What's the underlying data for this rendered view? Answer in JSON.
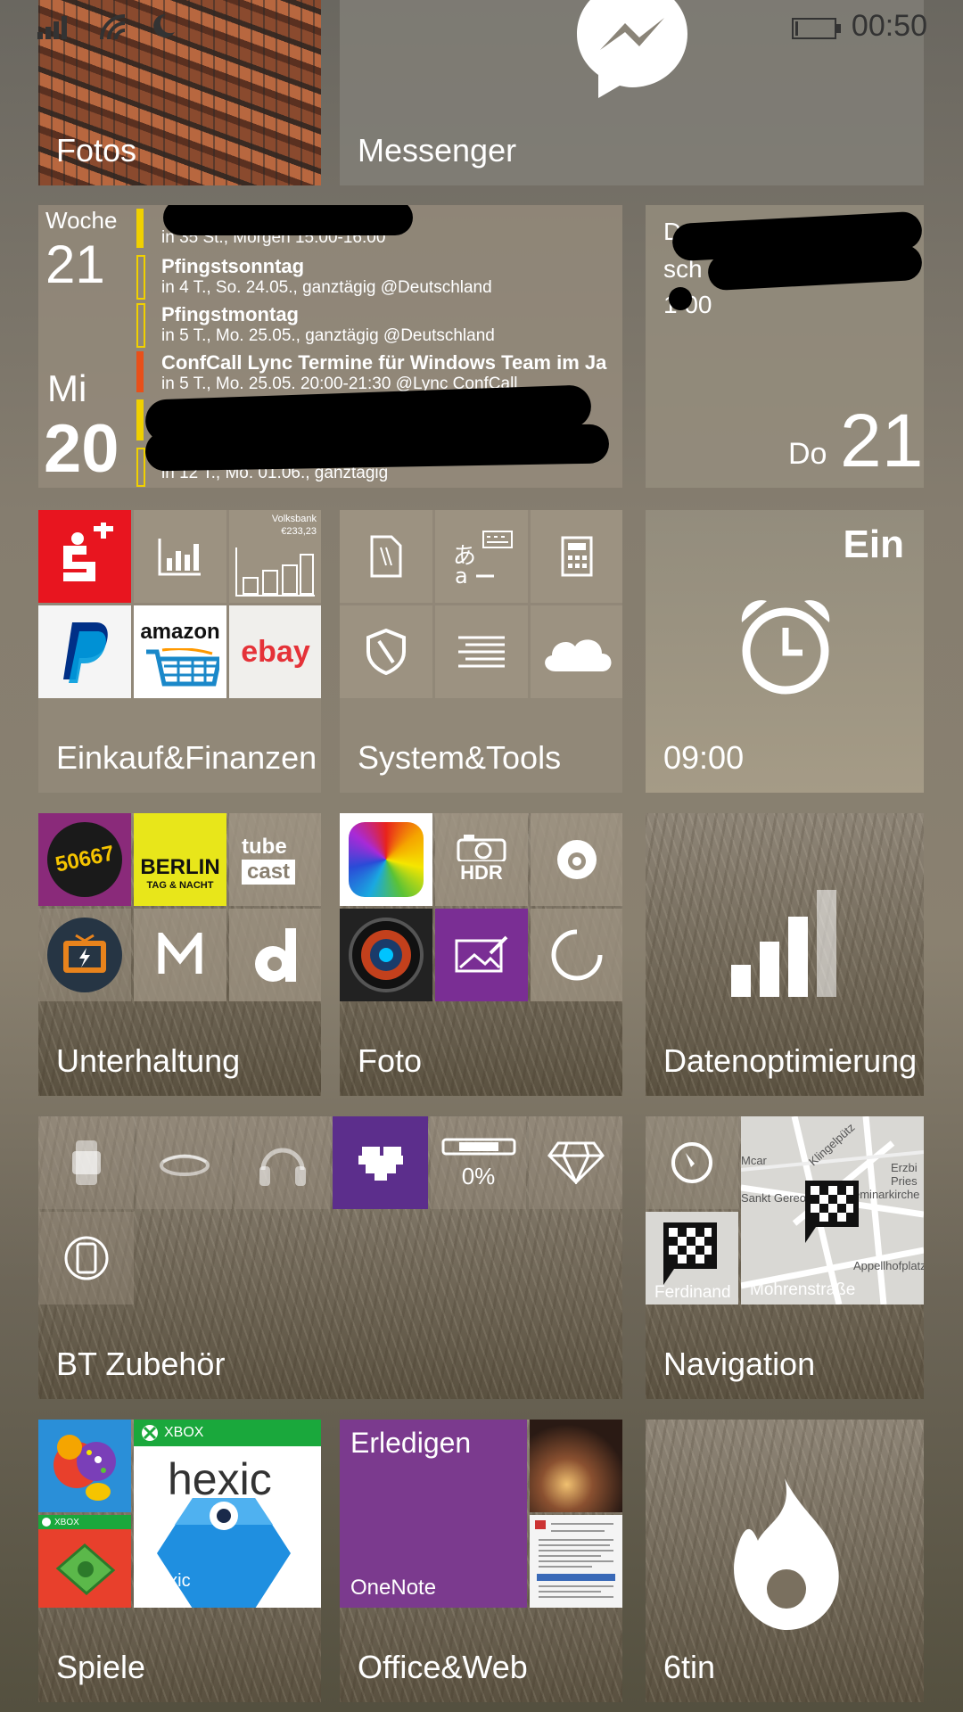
{
  "status_bar": {
    "time": "00:50"
  },
  "tiles": {
    "photos": {
      "label": "Fotos"
    },
    "messenger": {
      "label": "Messenger"
    },
    "calendar": {
      "week_label": "Woche",
      "week_number": "21",
      "weekday": "Mi",
      "day": "20",
      "events": [
        {
          "title": "",
          "sub": "in 35 St., Morgen 15:00-16:00",
          "color": "#f0d000"
        },
        {
          "title": "Pfingstsonntag",
          "sub": "in 4 T., So. 24.05., ganztägig @Deutschland",
          "color": "#f0d000"
        },
        {
          "title": "Pfingstmontag",
          "sub": "in 5 T., Mo. 25.05., ganztägig @Deutschland",
          "color": "#f0d000"
        },
        {
          "title": "ConfCall Lync Termine für Windows Team im Ja",
          "sub": "in 5 T., Mo. 25.05. 20:00-21:30 @Lync ConfCall",
          "color": "#e8501a"
        },
        {
          "title": "",
          "sub": "",
          "color": "#f0d000"
        },
        {
          "title": "",
          "sub": "in 12 T., Mo. 01.06., ganztägig",
          "color": "#f0d000"
        }
      ]
    },
    "reminder": {
      "line1": "D",
      "line2": "sch",
      "line3": "1 00",
      "weekday": "Do",
      "day": "21"
    },
    "shopping": {
      "label": "Einkauf&Finanzen",
      "volksbank_name": "Volksbank",
      "volksbank_amount": "€233,23",
      "amazon": "amazon",
      "ebay": "ebay"
    },
    "system": {
      "label": "System&Tools"
    },
    "alarm": {
      "state": "Ein",
      "time": "09:00"
    },
    "entertainment": {
      "label": "Unterhaltung",
      "app1": "50667",
      "app2": "BERLIN",
      "app2_sub": "TAG & NACHT",
      "app3_line1": "tube",
      "app3_line2": "cast"
    },
    "photo_folder": {
      "label": "Foto",
      "hdr": "HDR"
    },
    "data_sense": {
      "label": "Datenoptimierung"
    },
    "bt": {
      "label": "BT Zubehör",
      "battery": "0%"
    },
    "navigation": {
      "label": "Navigation",
      "street1": "Ferdinand",
      "street2": "Mohrenstraße",
      "poi1": "Sankt Gereon",
      "poi2": "Appellhofplatz",
      "poi3": "Klingelpütz",
      "poi4": "Erzbi Pries",
      "poi5": "eminarkirche",
      "poi6": "Mcar"
    },
    "games": {
      "label": "Spiele",
      "xbox": "XBOX",
      "xbox_small": "XBOX",
      "hexic": "hexic",
      "hexic_small": "exic"
    },
    "office": {
      "label": "Office&Web",
      "todo": "Erledigen",
      "onenote": "OneNote"
    },
    "tin": {
      "label": "6tin"
    }
  },
  "colors": {
    "samsung_red": "#e8151f",
    "purple": "#7a2e94",
    "onenote_purple": "#7b3a8e",
    "xbox_green": "#1aa83c"
  }
}
